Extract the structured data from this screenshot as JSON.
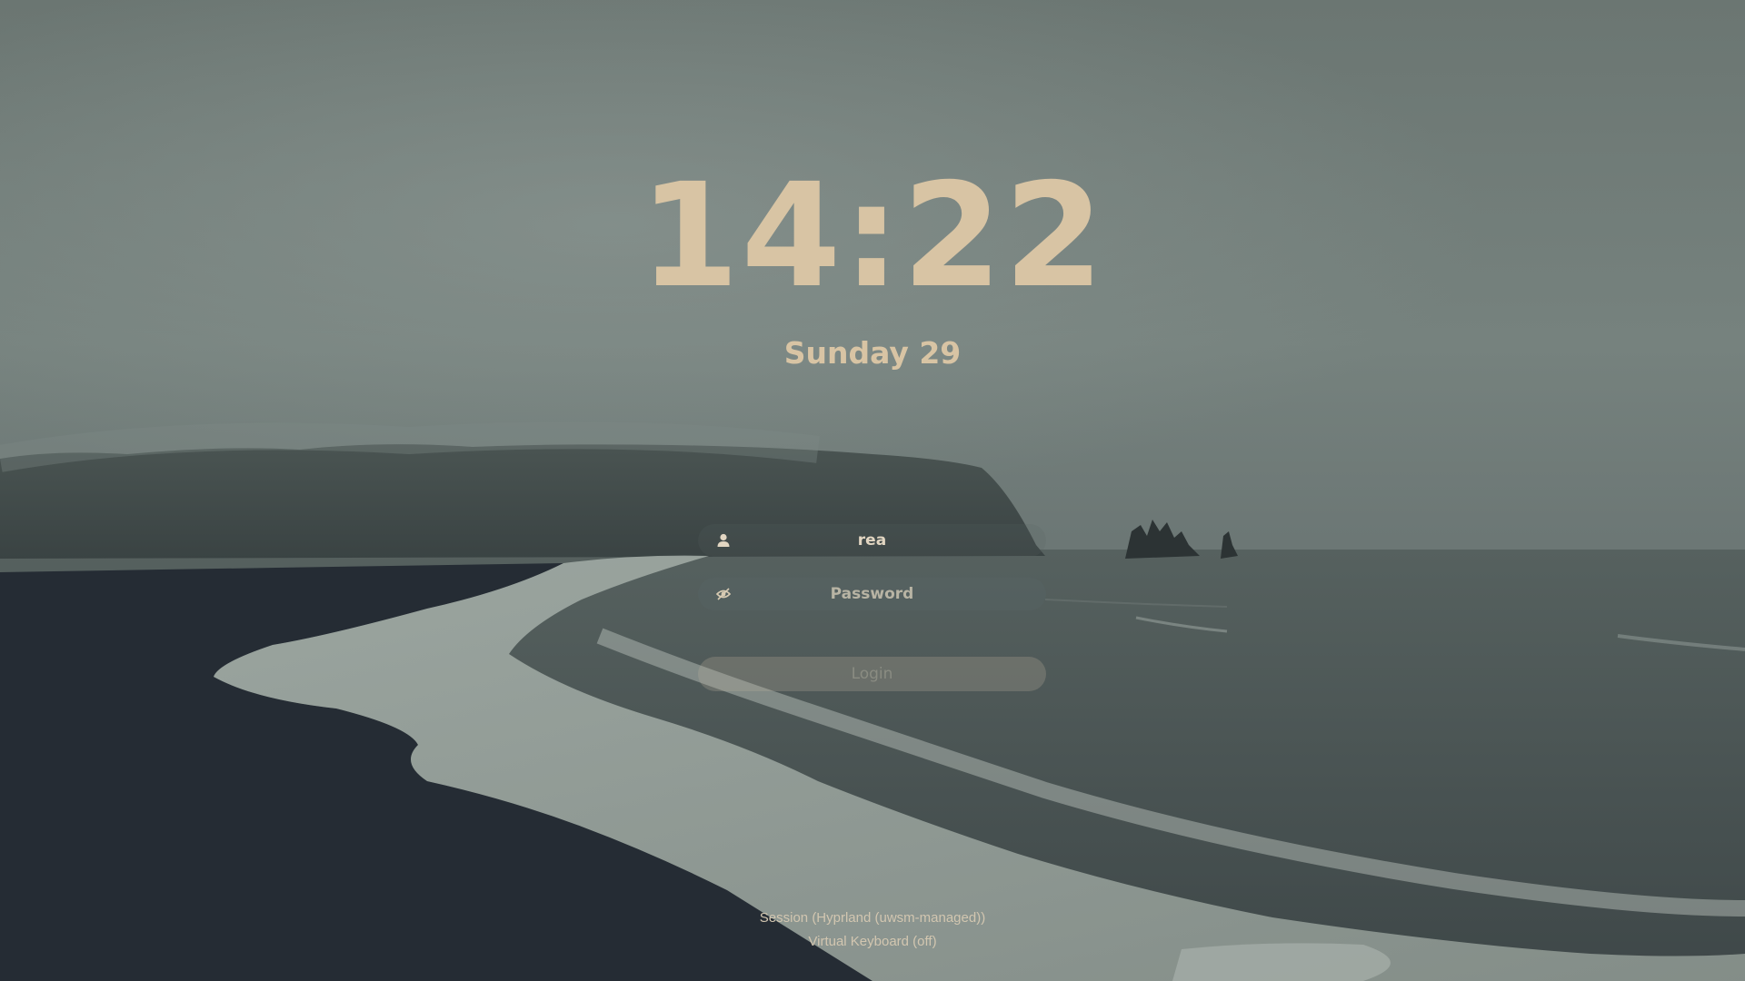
{
  "colors": {
    "accent": "#d8c4a4",
    "placeholder": "#a8aea6",
    "login_text": "#8a8c82",
    "login_bg": "rgba(190,180,160,0.25)",
    "footer_text": "#d2c6b0"
  },
  "clock": {
    "time": "14:22",
    "date": "Sunday 29"
  },
  "login": {
    "username_icon": "user-icon",
    "username": "rea",
    "password_icon": "eye-slash-icon",
    "password_placeholder": "Password",
    "password_value": "",
    "login_label": "Login"
  },
  "footer": {
    "session_label": "Session (Hyprland (uwsm-managed))",
    "virtual_keyboard_label": "Virtual Keyboard (off)"
  }
}
